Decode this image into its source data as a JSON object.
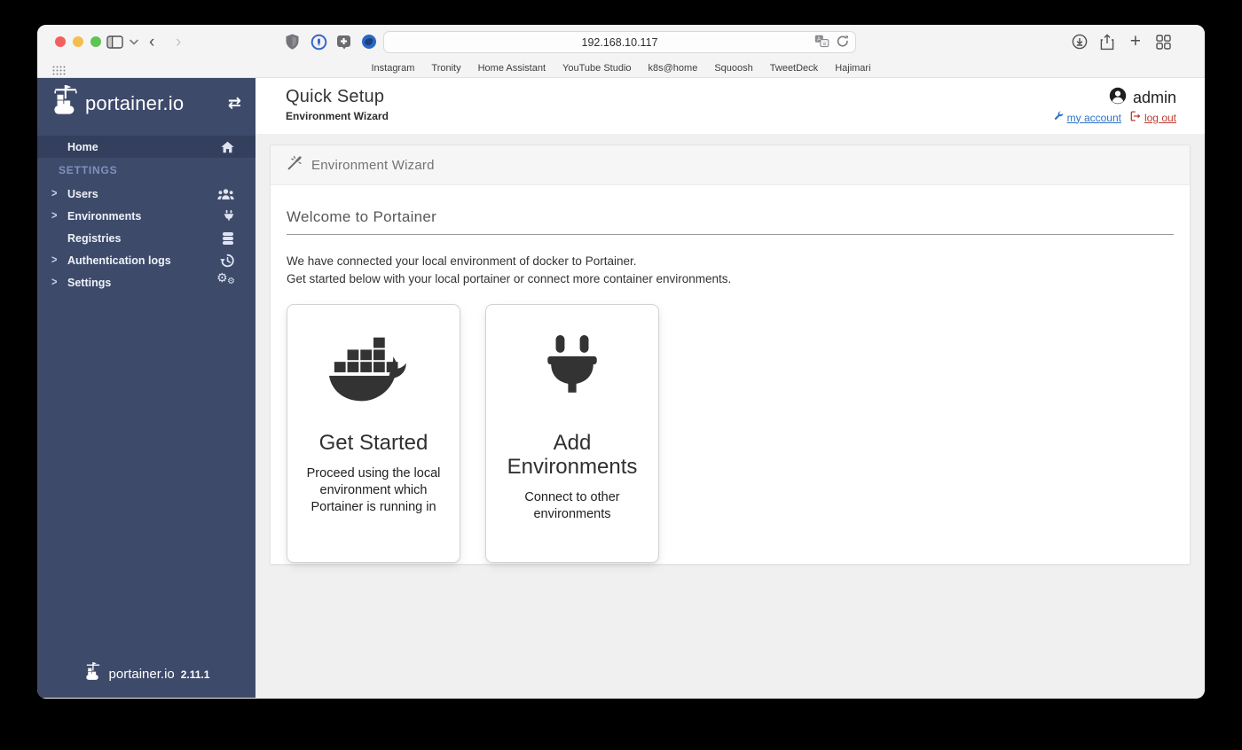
{
  "browser": {
    "url": "192.168.10.117",
    "bookmarks": [
      "Instagram",
      "Tronity",
      "Home Assistant",
      "YouTube Studio",
      "k8s@home",
      "Squoosh",
      "TweetDeck",
      "Hajimari"
    ]
  },
  "sidebar": {
    "logo_text": "portainer.io",
    "version": "2.11.1",
    "section_label": "SETTINGS",
    "items": [
      {
        "label": "Home",
        "icon": "home",
        "active": true,
        "has_chevron": false
      },
      {
        "label": "Users",
        "icon": "users",
        "active": false,
        "has_chevron": true
      },
      {
        "label": "Environments",
        "icon": "plug",
        "active": false,
        "has_chevron": true
      },
      {
        "label": "Registries",
        "icon": "database",
        "active": false,
        "has_chevron": false
      },
      {
        "label": "Authentication logs",
        "icon": "history",
        "active": false,
        "has_chevron": true
      },
      {
        "label": "Settings",
        "icon": "cogs",
        "active": false,
        "has_chevron": true
      }
    ]
  },
  "header": {
    "title": "Quick Setup",
    "subtitle": "Environment Wizard",
    "user": "admin",
    "my_account_label": "my account",
    "log_out_label": "log out"
  },
  "wizard": {
    "panel_title": "Environment Wizard",
    "welcome_title": "Welcome to Portainer",
    "intro_line1": "We have connected your local environment of docker to Portainer.",
    "intro_line2": "Get started below with your local portainer or connect more container environments.",
    "cards": [
      {
        "title": "Get Started",
        "description": "Proceed using the local environment which Portainer is running in",
        "icon": "docker-whale"
      },
      {
        "title": "Add Environments",
        "description": "Connect to other environments",
        "icon": "plug"
      }
    ]
  },
  "colors": {
    "sidebar_bg": "#3e4a6a",
    "sidebar_active_bg": "#333f5c",
    "sidebar_section_text": "#8091c0",
    "link_blue": "#2d73c8",
    "logout_red": "#bf3a30",
    "page_bg": "#f0f0f0",
    "panel_header_bg": "#f6f6f6",
    "traffic_lights": [
      "#f1605f",
      "#f5bd4f",
      "#5ec454"
    ]
  }
}
